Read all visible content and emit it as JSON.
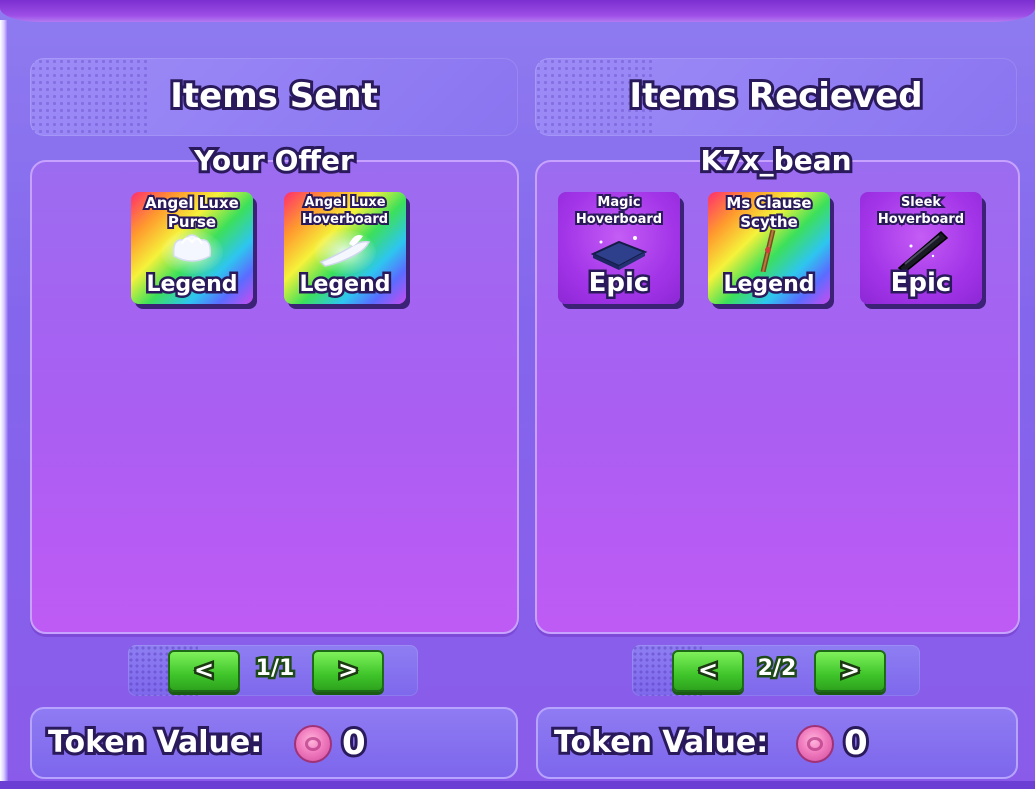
{
  "left": {
    "header": "Items Sent",
    "subtitle": "Your Offer",
    "items": [
      {
        "name": "Angel Luxe Purse",
        "rarity": "Legend"
      },
      {
        "name": "Angel Luxe Hoverboard",
        "rarity": "Legend"
      }
    ],
    "pager": {
      "prev": "<",
      "label": "1/1",
      "next": ">"
    },
    "token_label": "Token Value:",
    "token_value": "0"
  },
  "right": {
    "header": "Items Recieved",
    "subtitle": "K7x_bean",
    "items": [
      {
        "name": "Magic Hoverboard",
        "rarity": "Epic"
      },
      {
        "name": "Ms Clause Scythe",
        "rarity": "Legend"
      },
      {
        "name": "Sleek Hoverboard",
        "rarity": "Epic"
      }
    ],
    "pager": {
      "prev": "<",
      "label": "2/2",
      "next": ">"
    },
    "token_label": "Token Value:",
    "token_value": "0"
  },
  "colors": {
    "panel": "#aa5ef2",
    "legend_card": "rainbow",
    "epic_card": "#a335e8",
    "pager_button": "#3fc52a",
    "token_coin": "#f07bbe"
  },
  "icons": [
    "coin-icon",
    "chevron-left-icon",
    "chevron-right-icon"
  ]
}
